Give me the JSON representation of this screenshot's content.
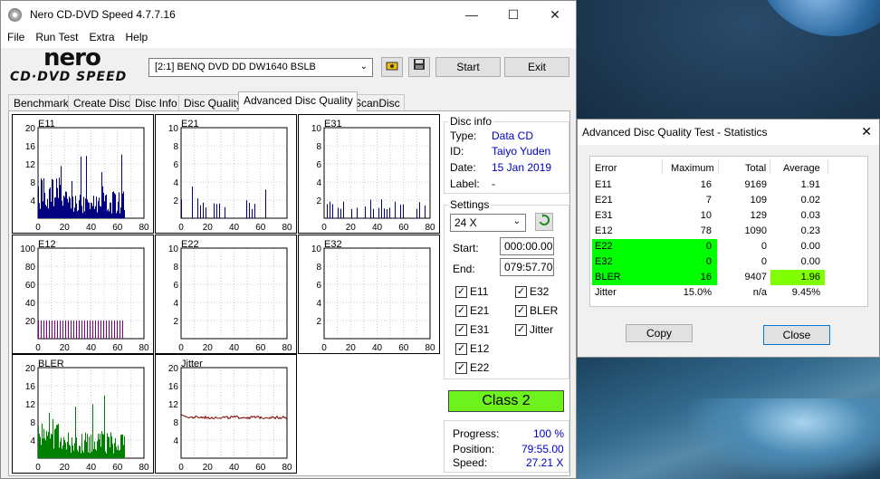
{
  "window": {
    "title": "Nero CD-DVD Speed 4.7.7.16",
    "controls": {
      "minimize": "—",
      "maximize": "☐",
      "close": "✕"
    }
  },
  "menu": [
    "File",
    "Run Test",
    "Extra",
    "Help"
  ],
  "logo": {
    "top": "nero",
    "bottom": "CD·DVD SPEED"
  },
  "toolbar": {
    "drive": "[2:1]   BENQ DVD DD DW1640 BSLB",
    "start_label": "Start",
    "exit_label": "Exit"
  },
  "tabs": [
    "Benchmark",
    "Create Disc",
    "Disc Info",
    "Disc Quality",
    "Advanced Disc Quality",
    "ScanDisc"
  ],
  "active_tab": "Advanced Disc Quality",
  "disc_info": {
    "group_title": "Disc info",
    "type_label": "Type:",
    "type": "Data CD",
    "id_label": "ID:",
    "id": "Taiyo Yuden",
    "date_label": "Date:",
    "date": "15 Jan 2019",
    "label_label": "Label:",
    "label": "-"
  },
  "settings": {
    "group_title": "Settings",
    "speed": "24 X",
    "start_label": "Start:",
    "start": "000:00.00",
    "end_label": "End:",
    "end": "079:57.70",
    "checks": [
      {
        "label": "E11",
        "checked": true
      },
      {
        "label": "E32",
        "checked": true
      },
      {
        "label": "E21",
        "checked": true
      },
      {
        "label": "BLER",
        "checked": true
      },
      {
        "label": "E31",
        "checked": true
      },
      {
        "label": "Jitter",
        "checked": true
      },
      {
        "label": "E12",
        "checked": true
      },
      {
        "label": "E22",
        "checked": true
      }
    ]
  },
  "class": "Class 2",
  "progress": {
    "progress_label": "Progress:",
    "progress": "100 %",
    "position_label": "Position:",
    "position": "79:55.00",
    "speed_label": "Speed:",
    "speed": "27.21 X"
  },
  "charts": [
    {
      "name": "E11",
      "yticks": [
        "20",
        "16",
        "12",
        "8",
        "4"
      ],
      "xticks": [
        "0",
        "20",
        "40",
        "60",
        "80"
      ],
      "color": "#000080"
    },
    {
      "name": "E21",
      "yticks": [
        "10",
        "8",
        "6",
        "4",
        "2"
      ],
      "xticks": [
        "0",
        "20",
        "40",
        "60",
        "80"
      ],
      "color": "#000080"
    },
    {
      "name": "E31",
      "yticks": [
        "10",
        "8",
        "6",
        "4",
        "2"
      ],
      "xticks": [
        "0",
        "20",
        "40",
        "60",
        "80"
      ],
      "color": "#000080"
    },
    {
      "name": "E12",
      "yticks": [
        "100",
        "80",
        "60",
        "40",
        "20"
      ],
      "xticks": [
        "0",
        "20",
        "40",
        "60",
        "80"
      ],
      "color": "#800080"
    },
    {
      "name": "E22",
      "yticks": [
        "10",
        "8",
        "6",
        "4",
        "2"
      ],
      "xticks": [
        "0",
        "20",
        "40",
        "60",
        "80"
      ],
      "color": "#000080"
    },
    {
      "name": "E32",
      "yticks": [
        "10",
        "8",
        "6",
        "4",
        "2"
      ],
      "xticks": [
        "0",
        "20",
        "40",
        "60",
        "80"
      ],
      "color": "#000080"
    },
    {
      "name": "BLER",
      "yticks": [
        "20",
        "16",
        "12",
        "8",
        "4"
      ],
      "xticks": [
        "0",
        "20",
        "40",
        "60",
        "80"
      ],
      "color": "#008000"
    },
    {
      "name": "Jitter",
      "yticks": [
        "20",
        "16",
        "12",
        "8",
        "4"
      ],
      "xticks": [
        "0",
        "20",
        "40",
        "60",
        "80"
      ],
      "color": "#800000"
    }
  ],
  "stats": {
    "title": "Advanced Disc Quality Test - Statistics",
    "headers": [
      "Error",
      "Maximum",
      "Total",
      "Average"
    ],
    "rows": [
      {
        "name": "E11",
        "max": "16",
        "total": "9169",
        "avg": "1.91"
      },
      {
        "name": "E21",
        "max": "7",
        "total": "109",
        "avg": "0.02"
      },
      {
        "name": "E31",
        "max": "10",
        "total": "129",
        "avg": "0.03"
      },
      {
        "name": "E12",
        "max": "78",
        "total": "1090",
        "avg": "0.23"
      },
      {
        "name": "E22",
        "max": "0",
        "total": "0",
        "avg": "0.00"
      },
      {
        "name": "E32",
        "max": "0",
        "total": "0",
        "avg": "0.00"
      },
      {
        "name": "BLER",
        "max": "16",
        "total": "9407",
        "avg": "1.96"
      },
      {
        "name": "Jitter",
        "max": "15.0%",
        "total": "n/a",
        "avg": "9.45%"
      }
    ],
    "copy_label": "Copy",
    "close_label": "Close"
  }
}
